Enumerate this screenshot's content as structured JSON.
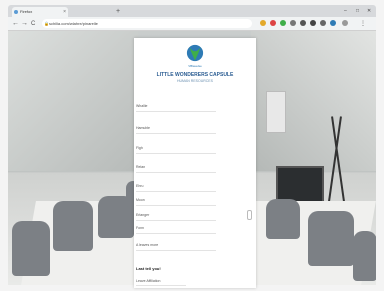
{
  "browser": {
    "tabs": [
      {
        "label": "Firefox"
      },
      {
        "label": ""
      }
    ],
    "new_tab_symbol": "+",
    "window_controls": {
      "minimize": "–",
      "maximize": "□",
      "close": "✕"
    },
    "nav": {
      "back": "←",
      "forward": "→",
      "reload": "C"
    },
    "url": "schilia.com/wlahre/pinarelle"
  },
  "form": {
    "logo_caption": "VBlauelse",
    "title": "LITTLE WONDERERS CAPSULE",
    "subtitle": "HUMAN RESOURCES",
    "fields": [
      {
        "label": "Whallie"
      },
      {
        "label": "Hamuble"
      },
      {
        "label": "Flgh"
      },
      {
        "label": "Relan"
      },
      {
        "label": "Ehru"
      },
      {
        "label": "Moon"
      },
      {
        "label": "Erlanger"
      },
      {
        "label": "Fonn"
      },
      {
        "label": "A leaves more"
      }
    ],
    "section": "Last tell you!",
    "bottom_field": "Leave Affiliation"
  },
  "colors": {
    "accent": "#2a5c92",
    "logo_green": "#3fae49",
    "logo_blue": "#2e7bb5"
  }
}
